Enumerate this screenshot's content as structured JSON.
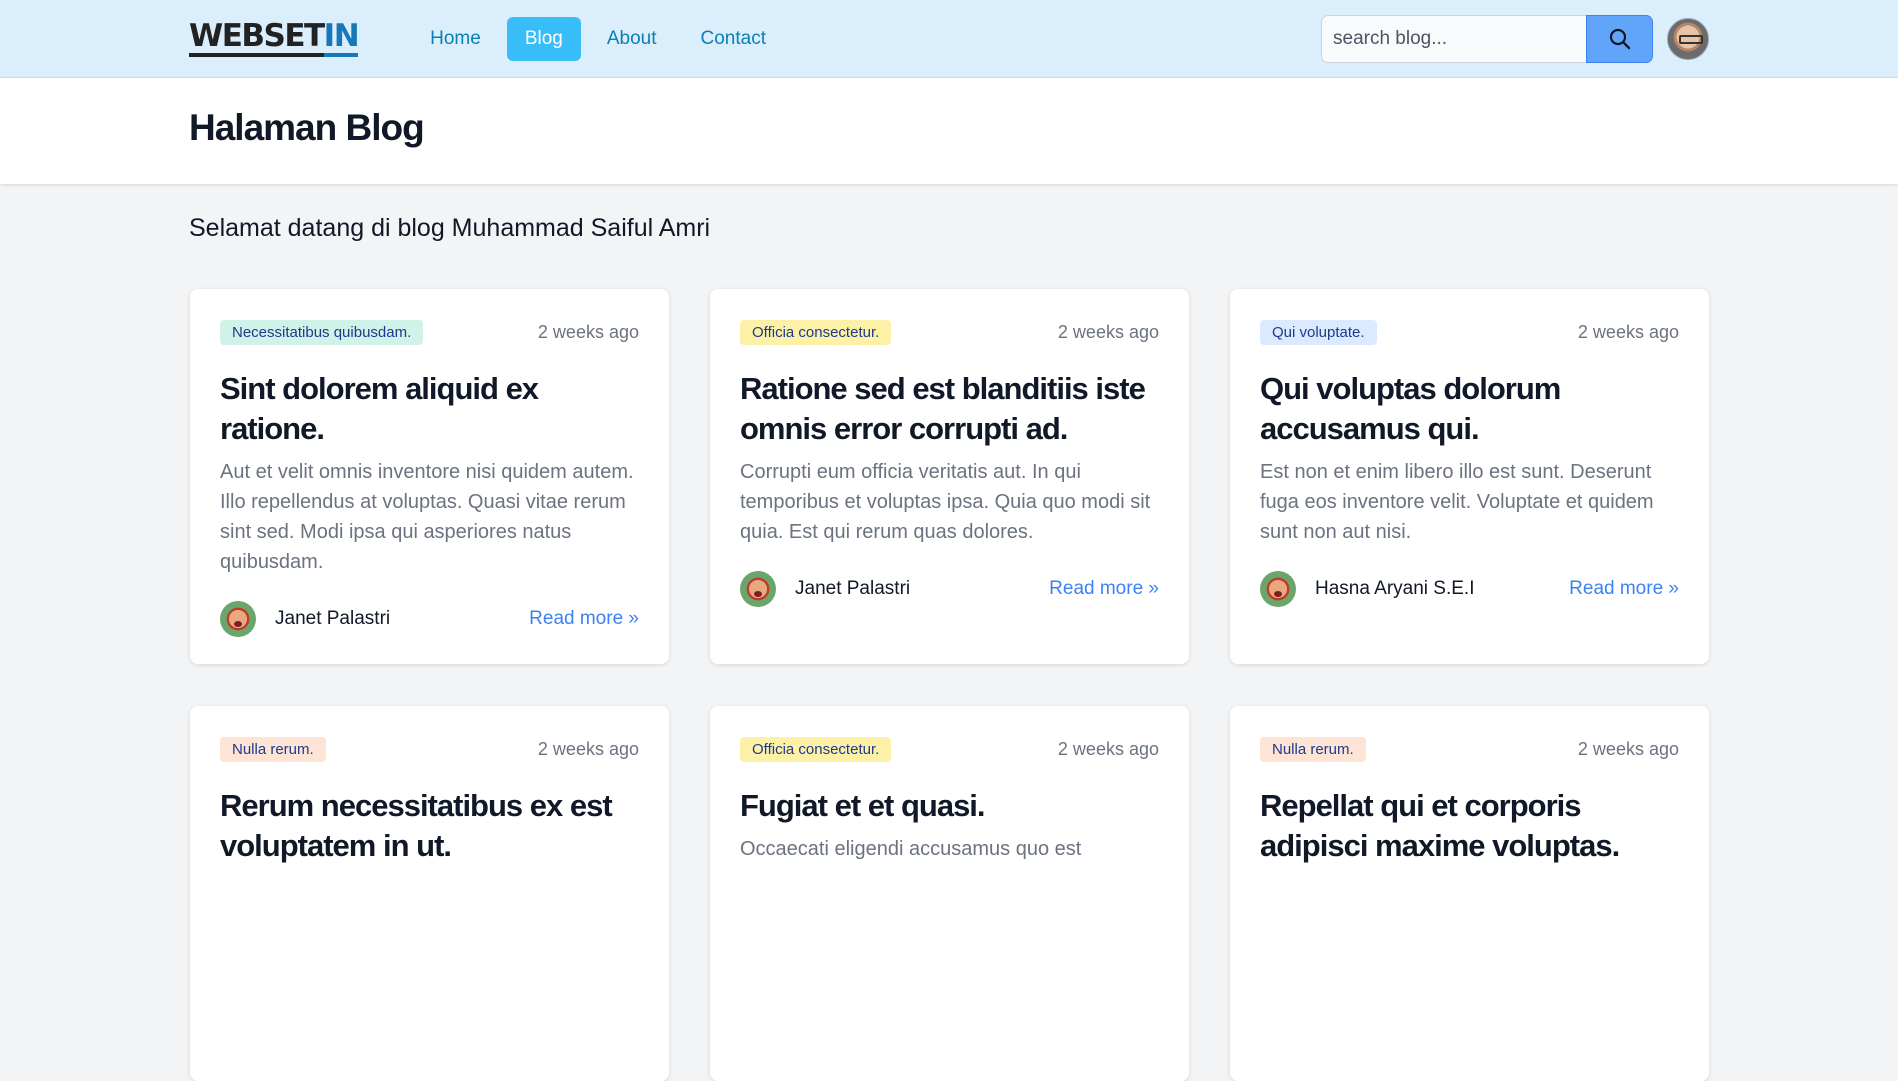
{
  "nav": {
    "logo_main": "WEBSET",
    "logo_accent": "IN",
    "links": [
      {
        "label": "Home",
        "active": false
      },
      {
        "label": "Blog",
        "active": true
      },
      {
        "label": "About",
        "active": false
      },
      {
        "label": "Contact",
        "active": false
      }
    ],
    "search_placeholder": "search blog...",
    "search_icon": "search-icon",
    "accent_color": "#38bdf8"
  },
  "header": {
    "title": "Halaman Blog"
  },
  "welcome": "Selamat datang di blog Muhammad Saiful Amri",
  "posts": [
    {
      "category": "Necessitatibus quibusdam.",
      "badge_color": "#d1f2e8",
      "time": "2 weeks ago",
      "title": "Sint dolorem aliquid ex ratione.",
      "excerpt": "Aut et velit omnis inventore nisi quidem autem. Illo repellendus at voluptas. Quasi vitae rerum sint sed. Modi ipsa qui asperiores natus quibusdam.",
      "author": "Janet Palastri",
      "read_more": "Read more »"
    },
    {
      "category": "Officia consectetur.",
      "badge_color": "#fdf1a8",
      "time": "2 weeks ago",
      "title": "Ratione sed est blanditiis iste omnis error corrupti ad.",
      "excerpt": "Corrupti eum officia veritatis aut. In qui temporibus et voluptas ipsa. Quia quo modi sit quia. Est qui rerum quas dolores.",
      "author": "Janet Palastri",
      "read_more": "Read more »"
    },
    {
      "category": "Qui voluptate.",
      "badge_color": "#dbeafe",
      "time": "2 weeks ago",
      "title": "Qui voluptas dolorum accusamus qui.",
      "excerpt": "Est non et enim libero illo est sunt. Deserunt fuga eos inventore velit. Voluptate et quidem sunt non aut nisi.",
      "author": "Hasna Aryani S.E.I",
      "read_more": "Read more »"
    },
    {
      "category": "Nulla rerum.",
      "badge_color": "#fde4d4",
      "time": "2 weeks ago",
      "title": "Rerum necessitatibus ex est voluptatem in ut.",
      "excerpt": "",
      "author": "",
      "read_more": ""
    },
    {
      "category": "Officia consectetur.",
      "badge_color": "#fdf1a8",
      "time": "2 weeks ago",
      "title": "Fugiat et et quasi.",
      "excerpt": "Occaecati eligendi accusamus quo est",
      "author": "",
      "read_more": ""
    },
    {
      "category": "Nulla rerum.",
      "badge_color": "#fde4d4",
      "time": "2 weeks ago",
      "title": "Repellat qui et corporis adipisci maxime voluptas.",
      "excerpt": "",
      "author": "",
      "read_more": ""
    }
  ]
}
